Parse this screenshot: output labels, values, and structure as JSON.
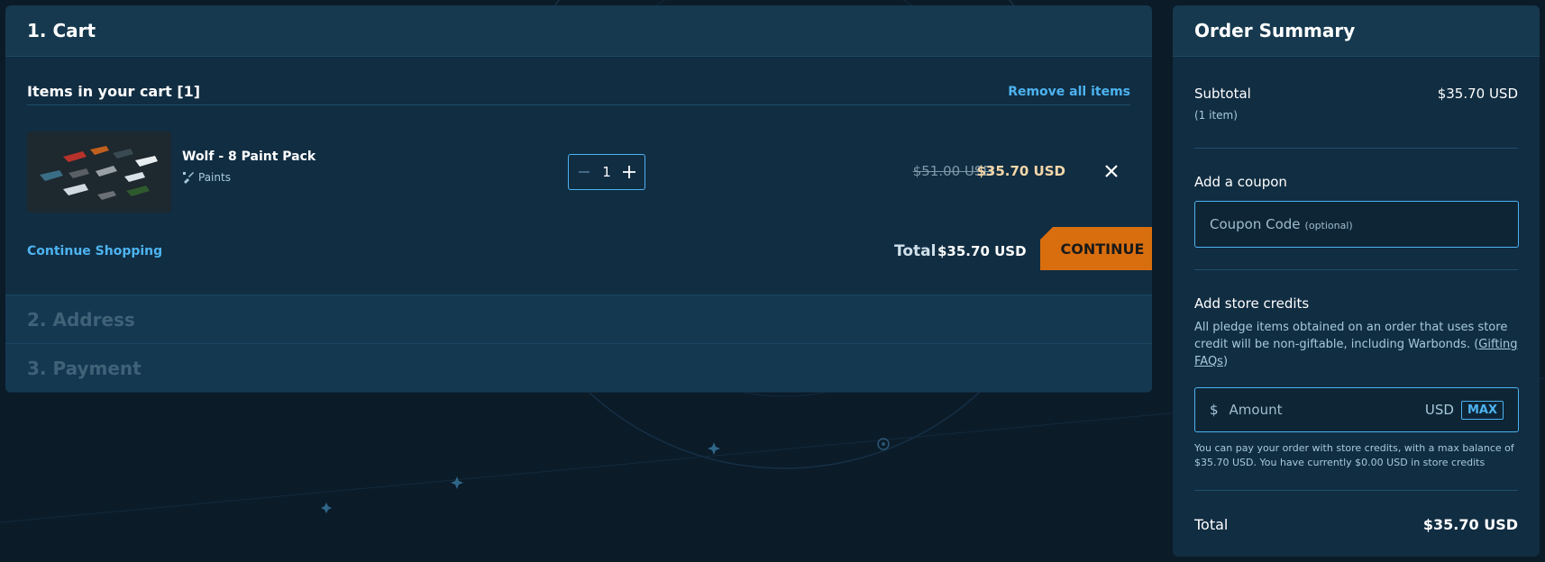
{
  "cart": {
    "step_title": "1. Cart",
    "items_label": "Items in your cart [1]",
    "remove_all": "Remove all items",
    "item": {
      "name": "Wolf - 8 Paint Pack",
      "category": "Paints",
      "quantity": "1",
      "old_price": "$51.00 USD",
      "new_price": "$35.70 USD"
    },
    "continue_shopping": "Continue Shopping",
    "total_label": "Total",
    "total_value": "$35.70 USD",
    "continue_button": "CONTINUE"
  },
  "steps": {
    "address": "2. Address",
    "payment": "3. Payment"
  },
  "summary": {
    "title": "Order Summary",
    "subtotal_label": "Subtotal",
    "subtotal_value": "$35.70 USD",
    "item_count": "(1 item)",
    "coupon_heading": "Add a coupon",
    "coupon_placeholder": "Coupon Code",
    "coupon_optional": "(optional)",
    "credits_heading": "Add store credits",
    "credits_note_1": "All pledge items obtained on an order that uses store",
    "credits_note_2": "credit will be non-giftable, including Warbonds. (",
    "credits_link_1": "Gifting",
    "credits_link_2": "FAQs",
    "credits_note_close": ")",
    "currency_symbol": "$",
    "amount_placeholder": "Amount",
    "currency": "USD",
    "max_button": "MAX",
    "credits_info_1": "You can pay your order with store credits, with a max balance of",
    "credits_info_2": "$35.70 USD. You have currently $0.00 USD in store credits",
    "total_label": "Total",
    "total_value": "$35.70 USD"
  },
  "colors": {
    "accent": "#4db3f0",
    "continue": "#d96e0f",
    "panel": "#112d42",
    "background": "#0b1b28"
  }
}
